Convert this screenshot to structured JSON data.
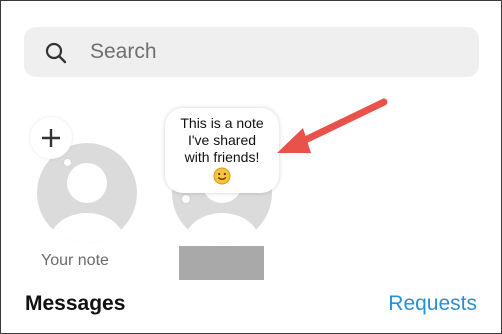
{
  "search": {
    "placeholder": "Search",
    "icon": "search-icon"
  },
  "notes": {
    "your_note": {
      "label": "Your note",
      "add_icon": "plus-icon"
    },
    "friend_note": {
      "lines": [
        "This is a note",
        "I've shared",
        "with friends!"
      ],
      "emoji": "smiley-emoji"
    }
  },
  "messages": {
    "title": "Messages",
    "requests_label": "Requests"
  },
  "colors": {
    "link": "#2a8fd3",
    "arrow": "#e9524a",
    "search_bg": "#efefef",
    "avatar": "#dbdbdb"
  }
}
